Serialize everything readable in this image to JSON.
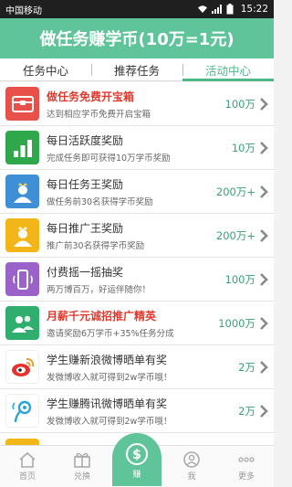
{
  "status": {
    "carrier": "中国移动",
    "time": "15:22"
  },
  "header": {
    "title": "做任务赚学币(10万=1元)"
  },
  "tabs": [
    {
      "label": "任务中心",
      "active": false
    },
    {
      "label": "推荐任务",
      "active": false
    },
    {
      "label": "活动中心",
      "active": true
    }
  ],
  "items": [
    {
      "icon": "treasure-chest-icon",
      "color": "#e8504a",
      "title": "做任务免费开宝箱",
      "title_red": true,
      "subtitle": "达到相应学币免费开启宝箱",
      "value": "100万"
    },
    {
      "icon": "bar-chart-icon",
      "color": "#2ea84a",
      "title": "每日活跃度奖励",
      "title_red": false,
      "subtitle": "完成任务即可获得10万学币奖励",
      "value": "10万"
    },
    {
      "icon": "user-crown-icon",
      "color": "#3f8fd6",
      "title": "每日任务王奖励",
      "title_red": false,
      "subtitle": "做任务前30名获得学币奖励",
      "value": "200万+"
    },
    {
      "icon": "user-crown-icon",
      "color": "#f2b619",
      "title": "每日推广王奖励",
      "title_red": false,
      "subtitle": "推广前30名获得学币奖励",
      "value": "200万+"
    },
    {
      "icon": "phone-shake-icon",
      "color": "#9b63c9",
      "title": "付费摇一摇抽奖",
      "title_red": false,
      "subtitle": "两万博百万，好运伴随你！",
      "value": "100万"
    },
    {
      "icon": "users-icon",
      "color": "#2fae6e",
      "title": "月薪千元诚招推广精英",
      "title_red": true,
      "subtitle": "邀请奖励6万学币+35%任务分成",
      "value": "1000万"
    },
    {
      "icon": "weibo-icon",
      "color": "#e06a2a",
      "title": "学生赚新浪微博晒单有奖",
      "title_red": false,
      "subtitle": "发微博收入就可得到2w学币哦！",
      "value": "2万"
    },
    {
      "icon": "tencent-weibo-icon",
      "color": "#2ba4d8",
      "title": "学生赚腾讯微博晒单有奖",
      "title_red": false,
      "subtitle": "发微博收入就可得到2w学币哦！",
      "value": "2万"
    }
  ],
  "bottom_nav": [
    {
      "label": "首页",
      "icon": "home-icon"
    },
    {
      "label": "兑换",
      "icon": "gift-icon"
    },
    {
      "label": "赚",
      "icon": "dollar-coin-icon",
      "active": true
    },
    {
      "label": "我",
      "icon": "user-icon"
    },
    {
      "label": "更多",
      "icon": "more-icon"
    }
  ]
}
